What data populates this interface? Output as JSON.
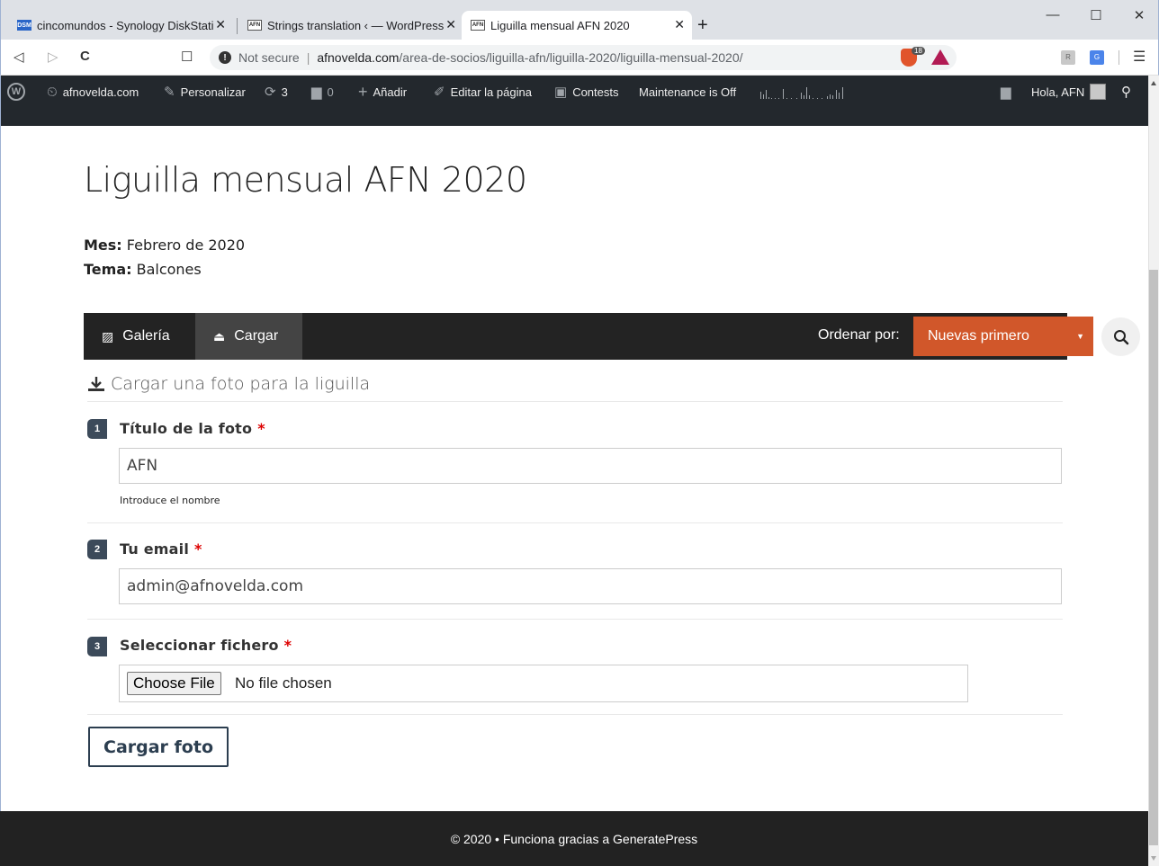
{
  "browser": {
    "tabs": [
      {
        "title": "cincomundos - Synology DiskStati",
        "favicon": "DSM"
      },
      {
        "title": "Strings translation ‹ — WordPress",
        "favicon": "AFN"
      },
      {
        "title": "Liguilla mensual AFN 2020",
        "favicon": "AFN",
        "active": true
      }
    ],
    "tab_close": "✕",
    "new_tab": "+",
    "window": {
      "minimize": "—",
      "maximize": "☐",
      "close": "✕"
    },
    "nav": {
      "back": "◁",
      "forward": "▷",
      "reload": "C",
      "bookmark": "☐"
    },
    "address": {
      "security_label": "Not secure",
      "host": "afnovelda.com",
      "path": "/area-de-socios/liguilla-afn/liguilla-2020/liguilla-mensual-2020/"
    },
    "brave_count": "18",
    "menu": "☰"
  },
  "adminbar": {
    "site_name": "afnovelda.com",
    "customize": "Personalizar",
    "updates_count": "3",
    "comments_count": "0",
    "add_new": "Añadir",
    "edit_page": "Editar la página",
    "contests": "Contests",
    "maintenance": "Maintenance is Off",
    "greeting": "Hola, AFN"
  },
  "page": {
    "title": "Liguilla mensual AFN 2020",
    "month_label": "Mes:",
    "month_value": " Febrero de 2020",
    "theme_label": "Tema:",
    "theme_value": " Balcones"
  },
  "contest_bar": {
    "gallery": "Galería",
    "upload": "Cargar",
    "order_label": "Ordenar por:",
    "order_selected": "Nuevas primero",
    "order_caret": "▼"
  },
  "upload_form": {
    "heading": "Cargar una foto para la liguilla",
    "steps": [
      {
        "number": "1",
        "label": "Título de la foto",
        "required_mark": "*",
        "value": "AFN",
        "hint": "Introduce el nombre"
      },
      {
        "number": "2",
        "label": "Tu email",
        "required_mark": "*",
        "value": "admin@afnovelda.com"
      },
      {
        "number": "3",
        "label": "Seleccionar fichero",
        "required_mark": "*",
        "button": "Choose File",
        "status": "No file chosen"
      }
    ],
    "submit": "Cargar foto"
  },
  "footer": {
    "text": "© 2020 • Funciona gracias a GeneratePress"
  },
  "colors": {
    "accent": "#d1572a",
    "adminbar": "#23282d",
    "contest_bar": "#232323",
    "footer": "#222222",
    "step_badge": "#3c4a5a"
  }
}
